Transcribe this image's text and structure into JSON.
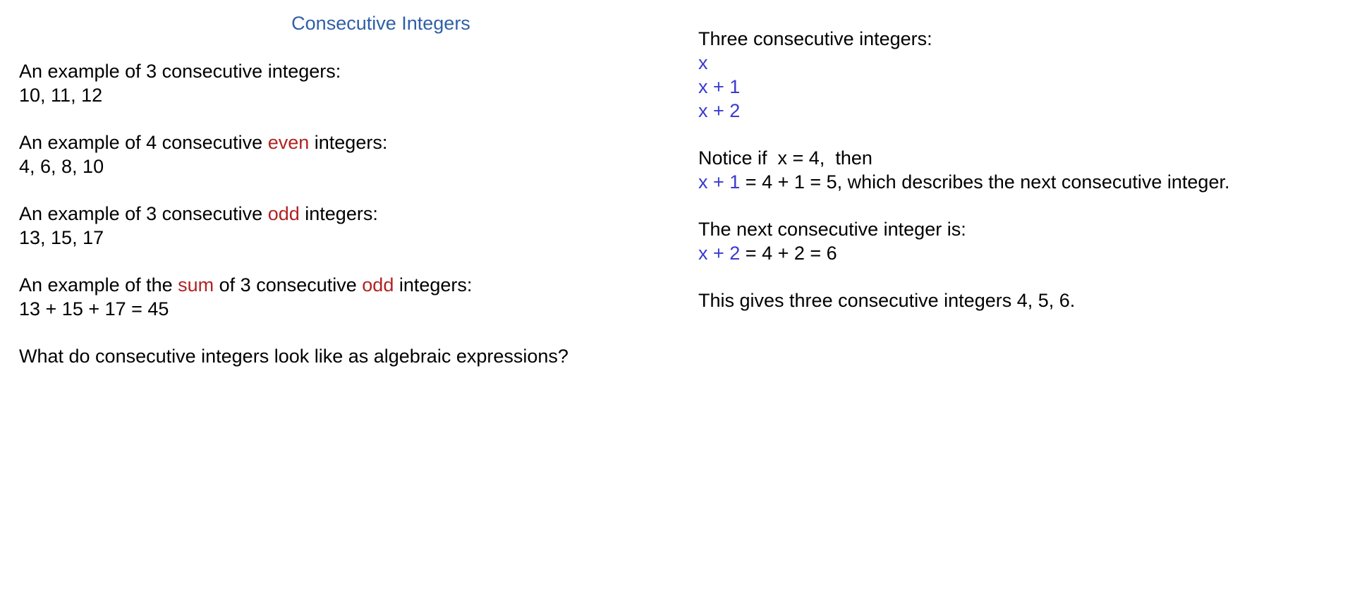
{
  "title": "Consecutive Integers",
  "colors": {
    "title": "#2f5fa8",
    "emphasis_red": "#b22222",
    "expression_blue": "#3a3acf",
    "text": "#000000"
  },
  "left": {
    "ex1_heading": "An example of 3 consecutive integers:",
    "ex1_value": "10, 11, 12",
    "ex2_heading_pre": "An example of 4 consecutive ",
    "ex2_heading_em": "even",
    "ex2_heading_post": " integers:",
    "ex2_value": "4, 6, 8, 10",
    "ex3_heading_pre": "An example of 3 consecutive ",
    "ex3_heading_em": "odd",
    "ex3_heading_post": " integers:",
    "ex3_value": "13, 15, 17",
    "ex4_heading_pre": "An example of the ",
    "ex4_heading_em1": "sum",
    "ex4_heading_mid": " of 3 consecutive ",
    "ex4_heading_em2": "odd",
    "ex4_heading_post": " integers:",
    "ex4_value": "13 + 15 + 17 = 45",
    "question": "What do consecutive integers look like as algebraic expressions?"
  },
  "right": {
    "heading": "Three consecutive integers:",
    "expr1": "x",
    "expr2": "x + 1",
    "expr3": "x + 2",
    "notice": "Notice if  x = 4,  then",
    "step1_expr": "x + 1",
    "step1_rest": " = 4 + 1 = 5, which describes the next consecutive integer.",
    "next_heading": "The next consecutive integer is:",
    "step2_expr": "x + 2",
    "step2_rest": " = 4 + 2 = 6",
    "conclusion": "This gives three consecutive integers 4, 5, 6."
  }
}
